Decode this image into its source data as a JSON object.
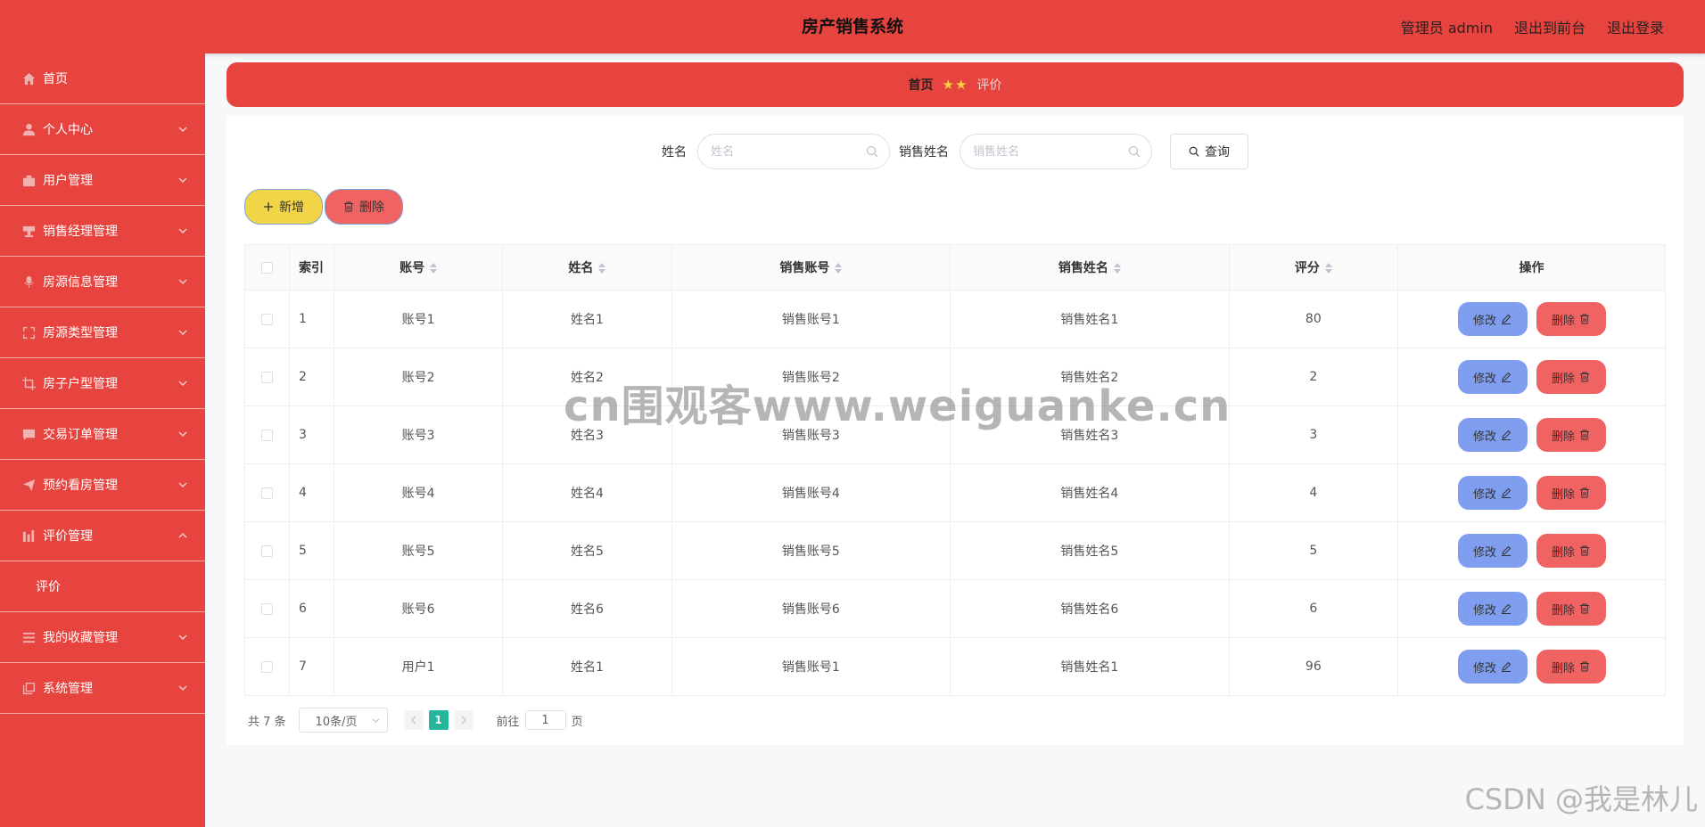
{
  "header": {
    "title": "房产销售系统",
    "user": "管理员 admin",
    "to_front": "退出到前台",
    "logout": "退出登录"
  },
  "sidebar": {
    "items": [
      {
        "label": "首页",
        "icon": "home-icon",
        "expandable": false
      },
      {
        "label": "个人中心",
        "icon": "user-icon",
        "expandable": true
      },
      {
        "label": "用户管理",
        "icon": "briefcase-icon",
        "expandable": true
      },
      {
        "label": "销售经理管理",
        "icon": "desk-icon",
        "expandable": true
      },
      {
        "label": "房源信息管理",
        "icon": "microphone-icon",
        "expandable": true
      },
      {
        "label": "房源类型管理",
        "icon": "fullscreen-icon",
        "expandable": true
      },
      {
        "label": "房子户型管理",
        "icon": "crop-icon",
        "expandable": true
      },
      {
        "label": "交易订单管理",
        "icon": "message-icon",
        "expandable": true
      },
      {
        "label": "预约看房管理",
        "icon": "send-icon",
        "expandable": true
      },
      {
        "label": "评价管理",
        "icon": "bar-chart-icon",
        "expandable": true,
        "expanded": true,
        "children": [
          "评价"
        ]
      },
      {
        "label": "我的收藏管理",
        "icon": "list-icon",
        "expandable": true
      },
      {
        "label": "系统管理",
        "icon": "copy-icon",
        "expandable": true
      }
    ]
  },
  "breadcrumb": {
    "home": "首页",
    "separator": "★★",
    "current": "评价"
  },
  "search": {
    "name_label": "姓名",
    "name_placeholder": "姓名",
    "sales_name_label": "销售姓名",
    "sales_name_placeholder": "销售姓名",
    "query_label": "查询"
  },
  "actions": {
    "add_label": "新增",
    "delete_label": "删除"
  },
  "table": {
    "columns": [
      "索引",
      "账号",
      "姓名",
      "销售账号",
      "销售姓名",
      "评分",
      "操作"
    ],
    "rows": [
      {
        "index": "1",
        "account": "账号1",
        "name": "姓名1",
        "sales_account": "销售账号1",
        "sales_name": "销售姓名1",
        "score": "80"
      },
      {
        "index": "2",
        "account": "账号2",
        "name": "姓名2",
        "sales_account": "销售账号2",
        "sales_name": "销售姓名2",
        "score": "2"
      },
      {
        "index": "3",
        "account": "账号3",
        "name": "姓名3",
        "sales_account": "销售账号3",
        "sales_name": "销售姓名3",
        "score": "3"
      },
      {
        "index": "4",
        "account": "账号4",
        "name": "姓名4",
        "sales_account": "销售账号4",
        "sales_name": "销售姓名4",
        "score": "4"
      },
      {
        "index": "5",
        "account": "账号5",
        "name": "姓名5",
        "sales_account": "销售账号5",
        "sales_name": "销售姓名5",
        "score": "5"
      },
      {
        "index": "6",
        "account": "账号6",
        "name": "姓名6",
        "sales_account": "销售账号6",
        "sales_name": "销售姓名6",
        "score": "6"
      },
      {
        "index": "7",
        "account": "用户1",
        "name": "姓名1",
        "sales_account": "销售账号1",
        "sales_name": "销售姓名1",
        "score": "96"
      }
    ],
    "edit_label": "修改",
    "row_delete_label": "删除"
  },
  "pagination": {
    "total": "共 7 条",
    "page_size": "10条/页",
    "current_page": "1",
    "goto_prefix": "前往",
    "goto_value": "1",
    "goto_suffix": "页"
  },
  "overlays": {
    "watermark": "cn围观客www.weiguanke.cn",
    "csdn": "CSDN @我是林儿"
  },
  "colors": {
    "primary_red": "#e8443f",
    "add_yellow": "#f2d547",
    "delete_red": "#f06363",
    "edit_blue": "#7f9ef0",
    "page_active": "#26b59a"
  }
}
